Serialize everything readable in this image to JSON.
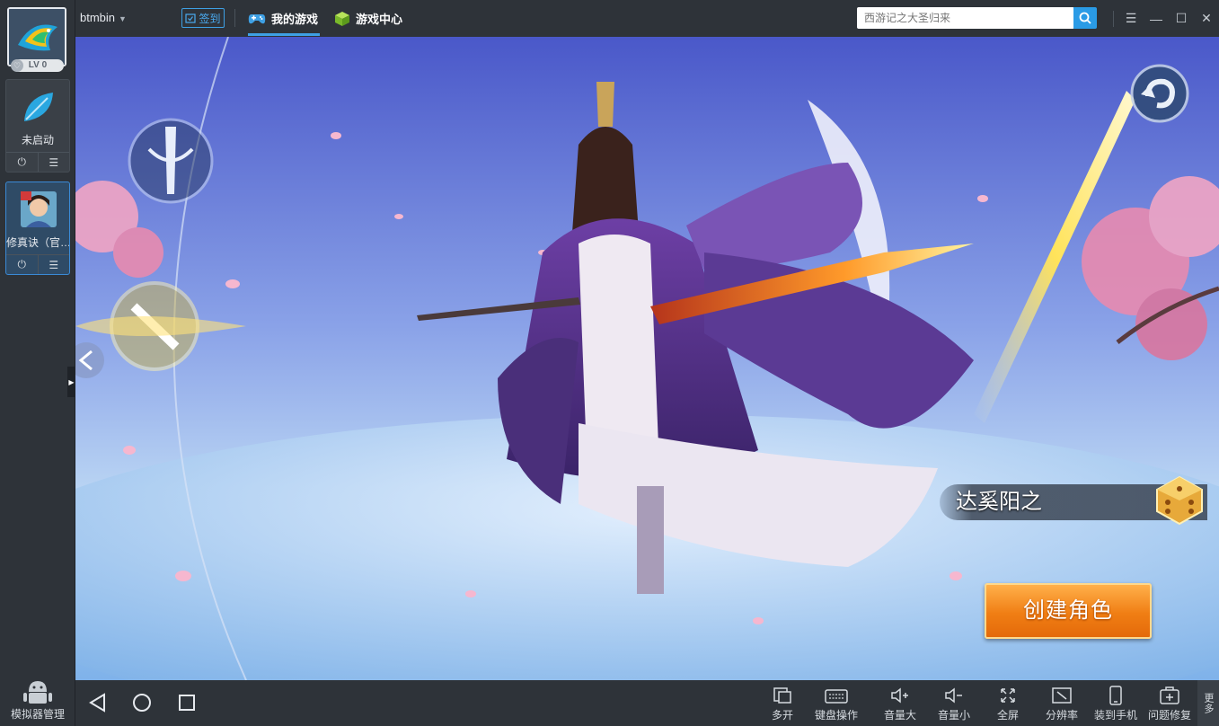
{
  "window": {
    "username": "btmbin",
    "signin_label": "签到",
    "tabs": [
      {
        "label": "我的游戏",
        "active": true
      },
      {
        "label": "游戏中心",
        "active": false
      }
    ],
    "search_placeholder": "西游记之大圣归来"
  },
  "sidebar": {
    "level_badge": "LV 0",
    "apps": [
      {
        "label": "未启动",
        "icon": "leaf-icon",
        "active": false
      },
      {
        "label": "修真诀（官…",
        "icon": "game-avatar-icon",
        "active": true
      }
    ],
    "simulator_manager_label": "模拟器管理"
  },
  "game": {
    "character_name": "达奚阳之",
    "create_button_label": "创建角色"
  },
  "toolbar": {
    "tools": [
      {
        "label": "多开",
        "icon": "multi-window-icon"
      },
      {
        "label": "键盘操作",
        "icon": "keyboard-icon"
      },
      {
        "label": "音量大",
        "icon": "volume-up-icon"
      },
      {
        "label": "音量小",
        "icon": "volume-down-icon"
      },
      {
        "label": "全屏",
        "icon": "fullscreen-icon"
      },
      {
        "label": "分辨率",
        "icon": "resolution-icon"
      },
      {
        "label": "装到手机",
        "icon": "phone-icon"
      },
      {
        "label": "问题修复",
        "icon": "repair-icon"
      }
    ],
    "more_label": "更多"
  },
  "colors": {
    "accent": "#2a9be6",
    "chrome_bg": "#2e3339",
    "create_button": "#f07e14"
  }
}
